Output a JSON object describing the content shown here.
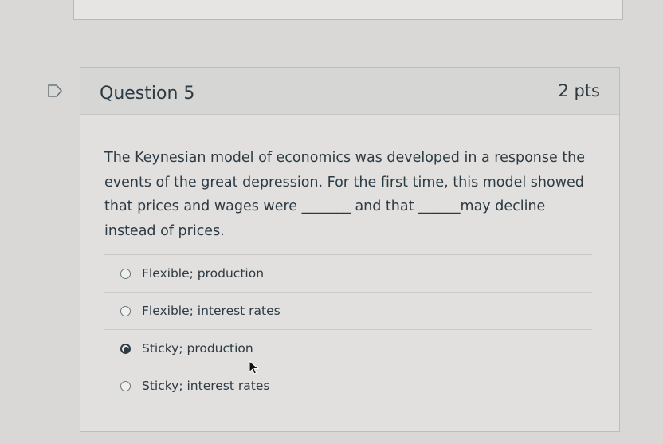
{
  "question": {
    "title": "Question 5",
    "points": "2 pts",
    "text": "The Keynesian model of economics was developed in a response the events of the great depression. For the first time, this model showed that prices and wages were _______ and that ______may decline instead of prices."
  },
  "answers": [
    {
      "label": "Flexible; production",
      "selected": false
    },
    {
      "label": "Flexible; interest rates",
      "selected": false
    },
    {
      "label": "Sticky; production",
      "selected": true
    },
    {
      "label": "Sticky; interest rates",
      "selected": false
    }
  ]
}
